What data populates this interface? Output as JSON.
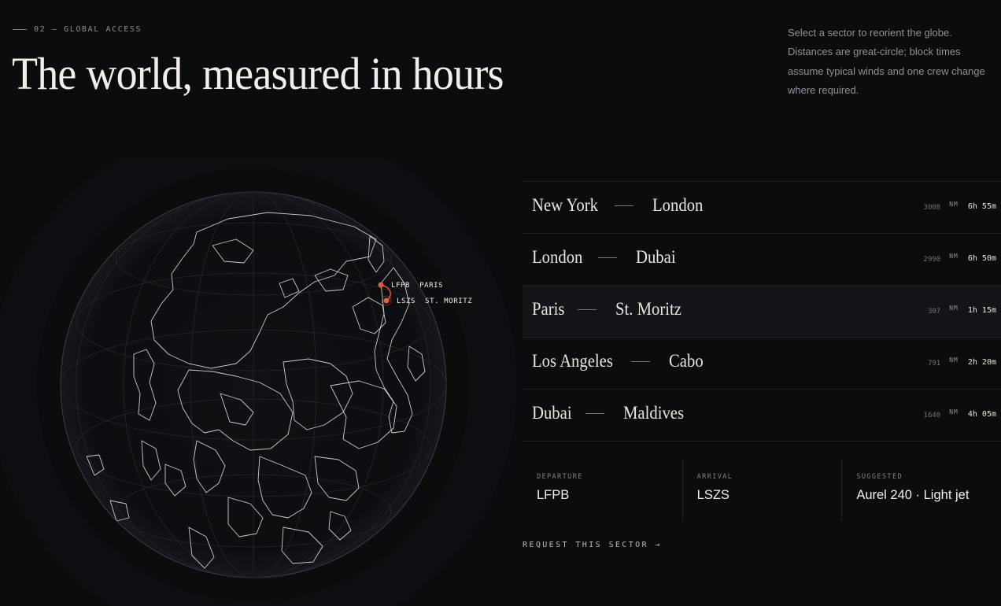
{
  "header": {
    "eyebrow": "02 — GLOBAL ACCESS",
    "title": "The world, measured in hours",
    "intro": "Select a sector to reorient the globe. Distances are great-circle; block times assume typical winds and one crew change where required."
  },
  "globe": {
    "pins": [
      {
        "code": "LFPB",
        "city": "PARIS"
      },
      {
        "code": "LSZS",
        "city": "ST. MORITZ"
      }
    ],
    "accent": "#d9552f"
  },
  "routes": [
    {
      "from": "New York",
      "to": "London",
      "nm": "3008",
      "unit": "NM",
      "time": "6h 55m",
      "active": false
    },
    {
      "from": "London",
      "to": "Dubai",
      "nm": "2990",
      "unit": "NM",
      "time": "6h 50m",
      "active": false
    },
    {
      "from": "Paris",
      "to": "St. Moritz",
      "nm": "307",
      "unit": "NM",
      "time": "1h 15m",
      "active": true
    },
    {
      "from": "Los Angeles",
      "to": "Cabo",
      "nm": "791",
      "unit": "NM",
      "time": "2h 20m",
      "active": false
    },
    {
      "from": "Dubai",
      "to": "Maldives",
      "nm": "1640",
      "unit": "NM",
      "time": "4h 05m",
      "active": false
    }
  ],
  "summary": {
    "departure": {
      "label": "DEPARTURE",
      "value": "LFPB"
    },
    "arrival": {
      "label": "ARRIVAL",
      "value": "LSZS"
    },
    "suggested": {
      "label": "SUGGESTED",
      "value": "Aurel 240 · Light jet"
    }
  },
  "cta": {
    "label": "REQUEST THIS SECTOR →"
  },
  "colors": {
    "background": "#0b0c0e",
    "accent": "#d9552f",
    "text": "#e8e6e1",
    "muted": "#8c9198"
  }
}
